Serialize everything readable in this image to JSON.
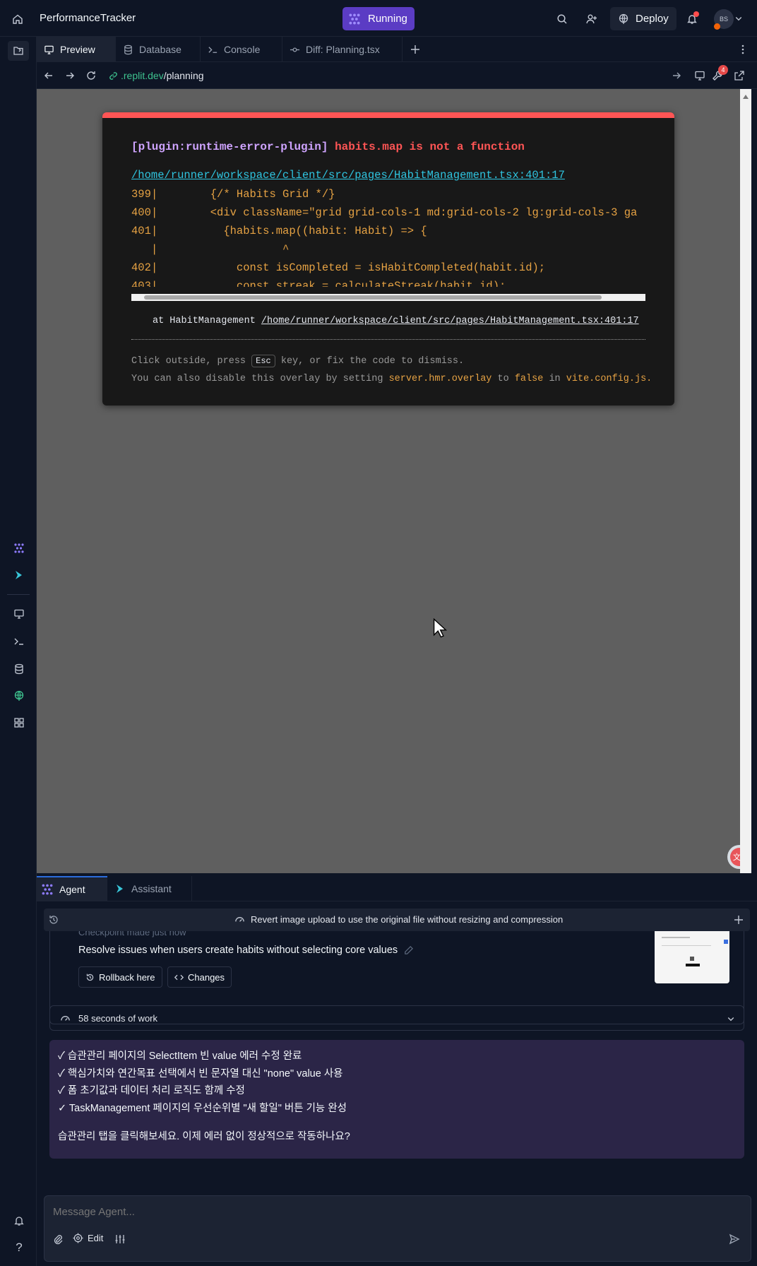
{
  "topbar": {
    "project_title": "PerformanceTracker",
    "run_label": "Running",
    "deploy_label": "Deploy",
    "avatar_initials": "BS"
  },
  "tabs": [
    {
      "label": "Preview",
      "icon": "monitor-icon"
    },
    {
      "label": "Database",
      "icon": "database-icon"
    },
    {
      "label": "Console",
      "icon": "terminal-icon"
    },
    {
      "label": "Diff: Planning.tsx",
      "icon": "git-commit-icon"
    }
  ],
  "url": {
    "domain": ".replit.dev",
    "path": "/planning",
    "badge": "4"
  },
  "error": {
    "plugin": "[plugin:runtime-error-plugin]",
    "message": "habits.map is not a function",
    "file_link": "/home/runner/workspace/client/src/pages/HabitManagement.tsx:401:17",
    "code_lines": [
      {
        "num": "399",
        "code": "        {/* Habits Grid */}"
      },
      {
        "num": "400",
        "code": "        <div className=\"grid grid-cols-1 md:grid-cols-2 lg:grid-cols-3 ga"
      },
      {
        "num": "401",
        "code": "          {habits.map((habit: Habit) => {"
      },
      {
        "num": "",
        "code": "                   ^"
      },
      {
        "num": "402",
        "code": "            const isCompleted = isHabitCompleted(habit.id);"
      },
      {
        "num": "403",
        "code": "            const streak = calculateStreak(habit.id);"
      }
    ],
    "stack_prefix": "at HabitManagement",
    "stack_link": "/home/runner/workspace/client/src/pages/HabitManagement.tsx:401:17",
    "tip_1a": "Click outside, press",
    "tip_key": "Esc",
    "tip_1b": "key, or fix the code to dismiss.",
    "tip_2a": "You can also disable this overlay by setting",
    "tip_2b": "server.hmr.overlay",
    "tip_2c": "to",
    "tip_2d": "false",
    "tip_2e": "in",
    "tip_2f": "vite.config.js."
  },
  "agent": {
    "tab_agent": "Agent",
    "tab_assistant": "Assistant",
    "revert_notice": "Revert image upload to use the original file without resizing and compression",
    "checkpoint_partial": "Checkpoint made just now",
    "checkpoint_text": "Resolve issues when users create habits without selecting core values",
    "rollback_label": "Rollback here",
    "changes_label": "Changes",
    "work_time": "58 seconds of work",
    "message_lines": [
      "✓ 습관관리 페이지의 SelectItem 빈 value 에러 수정 완료",
      "✓ 핵심가치와 연간목표 선택에서 빈 문자열 대신 \"none\" value 사용",
      "✓ 폼 초기값과 데이터 처리 로직도 함께 수정",
      "✓ TaskManagement 페이지의 우선순위별 \"새 할일\" 버튼 기능 완성"
    ],
    "message_question": "습관관리 탭을 클릭해보세요. 이제 에러 없이 정상적으로 작동하나요?",
    "input_placeholder": "Message Agent...",
    "edit_label": "Edit"
  },
  "colors": {
    "accent_purple": "#5b3cc4",
    "error_red": "#ff5555",
    "link_cyan": "#2fc5e0",
    "code_orange": "#e6a243",
    "plugin_purple": "#cfa4ff"
  }
}
